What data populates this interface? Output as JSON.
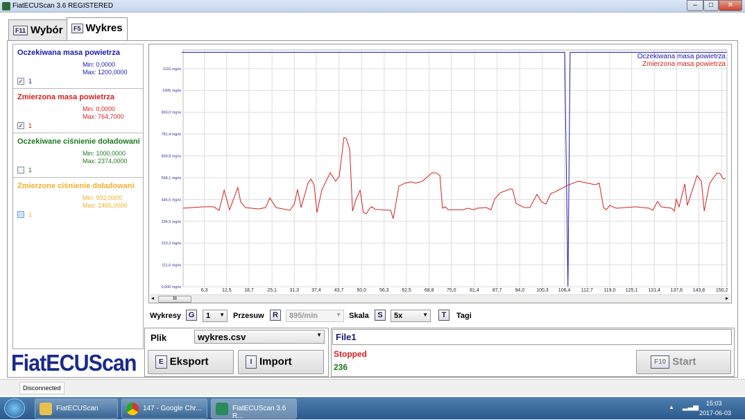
{
  "window": {
    "title": "FiatECUScan 3.6 REGISTERED"
  },
  "tabs": [
    {
      "key": "F11",
      "label": "Wybór"
    },
    {
      "key": "F5",
      "label": "Wykres"
    }
  ],
  "channels": [
    {
      "name": "Oczekiwana masa powietrza",
      "min": "Min: 0,0000",
      "max": "Max: 1200,0000",
      "checked": true,
      "num": "1",
      "color": "#1a1ab0"
    },
    {
      "name": "Zmierzona masa powietrza",
      "min": "Min: 0,0000",
      "max": "Max: 764,7000",
      "checked": true,
      "num": "1",
      "color": "#d42020"
    },
    {
      "name": "Oczekiwane ciśnienie doładowani",
      "min": "Min: 1000,0000",
      "max": "Max: 2374,0000",
      "checked": false,
      "num": "1",
      "color": "#1e7a1e"
    },
    {
      "name": "Zmierzone ciśnienie doładowani",
      "min": "Min: 992,0000",
      "max": "Max: 2465,0000",
      "checked": false,
      "num": "1",
      "color": "#f0b030"
    }
  ],
  "chart_data": {
    "type": "line",
    "xlabel": "",
    "ylabel": "",
    "xlim": [
      0,
      151.5
    ],
    "ylim": [
      0,
      1208
    ],
    "y_ticks": [
      0,
      111.6,
      223.3,
      334.9,
      446.5,
      558.1,
      669.8,
      781.4,
      893.0,
      1005,
      1116
    ],
    "y_tick_labels": [
      "0,000 mg/w",
      "111,6 mg/w",
      "223,3 mg/w",
      "334,9 mg/w",
      "446,5 mg/w",
      "558,1 mg/w",
      "669,8 mg/w",
      "781,4 mg/w",
      "893,0 mg/w",
      "1005 mg/w",
      "1116 mg/w"
    ],
    "x_ticks": [
      6.3,
      12.5,
      18.7,
      25.1,
      31.3,
      37.4,
      43.7,
      50.0,
      56.3,
      62.5,
      68.8,
      75.0,
      81.4,
      87.7,
      94.0,
      100.3,
      106.4,
      112.7,
      119.0,
      125.1,
      131.4,
      137.6,
      143.8,
      150.2
    ],
    "x_tick_labels": [
      "6,3",
      "12,5",
      "18,7",
      "25,1",
      "31,3",
      "37,4",
      "43,7",
      "50,0",
      "56,3",
      "62,5",
      "68,8",
      "75,0",
      "81,4",
      "87,7",
      "94,0",
      "100,3",
      "106,4",
      "112,7",
      "119,0",
      "125,1",
      "131,4",
      "137,6",
      "143,8",
      "150,2"
    ],
    "legend_position": "top-right",
    "grid": true,
    "series": [
      {
        "name": "Oczekiwana masa powietrza",
        "color": "#1a1ab0",
        "points": [
          [
            0,
            1200
          ],
          [
            106.5,
            1200
          ],
          [
            107.4,
            0
          ],
          [
            108.0,
            1200
          ],
          [
            151.5,
            1200
          ]
        ]
      },
      {
        "name": "Zmierzona masa powietrza",
        "color": "#d42020",
        "points": [
          [
            0.4,
            402
          ],
          [
            6.2,
            409
          ],
          [
            8.9,
            409
          ],
          [
            10.4,
            391
          ],
          [
            11.8,
            494
          ],
          [
            13.3,
            394
          ],
          [
            15.6,
            508
          ],
          [
            16.4,
            434
          ],
          [
            17.7,
            405
          ],
          [
            21.4,
            398
          ],
          [
            23.3,
            405
          ],
          [
            24.5,
            455
          ],
          [
            26.2,
            405
          ],
          [
            30.1,
            391
          ],
          [
            31.3,
            423
          ],
          [
            32.2,
            498
          ],
          [
            33.2,
            405
          ],
          [
            35.1,
            530
          ],
          [
            35.9,
            551
          ],
          [
            36.8,
            522
          ],
          [
            37.6,
            380
          ],
          [
            39.0,
            498
          ],
          [
            41.3,
            583
          ],
          [
            42.8,
            540
          ],
          [
            43.8,
            565
          ],
          [
            45.1,
            764
          ],
          [
            45.7,
            760
          ],
          [
            46.7,
            704
          ],
          [
            47.5,
            387
          ],
          [
            48.4,
            444
          ],
          [
            49.6,
            494
          ],
          [
            50.5,
            380
          ],
          [
            51.3,
            373
          ],
          [
            52.3,
            402
          ],
          [
            52.9,
            409
          ],
          [
            53.8,
            396
          ],
          [
            58.1,
            391
          ],
          [
            58.8,
            348
          ],
          [
            60.4,
            515
          ],
          [
            62.1,
            530
          ],
          [
            63.8,
            537
          ],
          [
            65.0,
            530
          ],
          [
            66.9,
            540
          ],
          [
            68.3,
            562
          ],
          [
            69.6,
            583
          ],
          [
            70.8,
            583
          ],
          [
            71.8,
            569
          ],
          [
            72.5,
            402
          ],
          [
            73.3,
            409
          ],
          [
            74.1,
            394
          ],
          [
            78.3,
            394
          ],
          [
            79.5,
            402
          ],
          [
            81.2,
            394
          ],
          [
            82.2,
            402
          ],
          [
            84.7,
            405
          ],
          [
            86.0,
            394
          ],
          [
            87.0,
            448
          ],
          [
            88.5,
            480
          ],
          [
            91.4,
            501
          ],
          [
            92.0,
            498
          ],
          [
            93.0,
            426
          ],
          [
            95.3,
            405
          ],
          [
            96.8,
            405
          ],
          [
            98.8,
            473
          ],
          [
            100.1,
            434
          ],
          [
            101.3,
            423
          ],
          [
            102.6,
            476
          ],
          [
            104.0,
            487
          ],
          [
            107.3,
            519
          ],
          [
            110.3,
            540
          ],
          [
            115.0,
            522
          ],
          [
            116.1,
            530
          ],
          [
            117.3,
            405
          ],
          [
            118.1,
            394
          ],
          [
            119.0,
            416
          ],
          [
            120.8,
            402
          ],
          [
            123.3,
            405
          ],
          [
            126.2,
            409
          ],
          [
            130.0,
            402
          ],
          [
            131.0,
            391
          ],
          [
            132.3,
            437
          ],
          [
            133.3,
            409
          ],
          [
            136.2,
            402
          ],
          [
            137.0,
            387
          ],
          [
            137.5,
            448
          ],
          [
            138.3,
            409
          ],
          [
            139.9,
            526
          ],
          [
            140.6,
            416
          ],
          [
            143.3,
            569
          ],
          [
            144.5,
            540
          ],
          [
            145.3,
            387
          ],
          [
            146.8,
            530
          ],
          [
            148.9,
            583
          ],
          [
            149.7,
            579
          ],
          [
            150.6,
            551
          ],
          [
            151.2,
            554
          ]
        ]
      }
    ]
  },
  "controls": {
    "wykresy_label": "Wykresy",
    "wykresy_key": "G",
    "wykresy_value": "1",
    "przesuw_label": "Przesuw",
    "przesuw_key": "R",
    "przesuw_value": "895/min",
    "skala_label": "Skala",
    "skala_key": "S",
    "skala_value": "5x",
    "tagi_key": "T",
    "tagi_label": "Tagi"
  },
  "file": {
    "label": "Plik",
    "value": "wykres.csv",
    "export_key": "E",
    "export_label": "Eksport",
    "import_key": "I",
    "import_label": "Import"
  },
  "run": {
    "file_name": "File1",
    "state": "Stopped",
    "count": "236",
    "start_key": "F10",
    "start_label": "Start"
  },
  "logo": "FiatECUScan",
  "statusbar": {
    "connection": "Disconnected"
  },
  "taskbar": {
    "items": [
      "FiatECUScan",
      "147 - Google Chr...",
      "FiatECUScan 3.6 R..."
    ],
    "time": "15:03",
    "date": "2017-06-03"
  }
}
